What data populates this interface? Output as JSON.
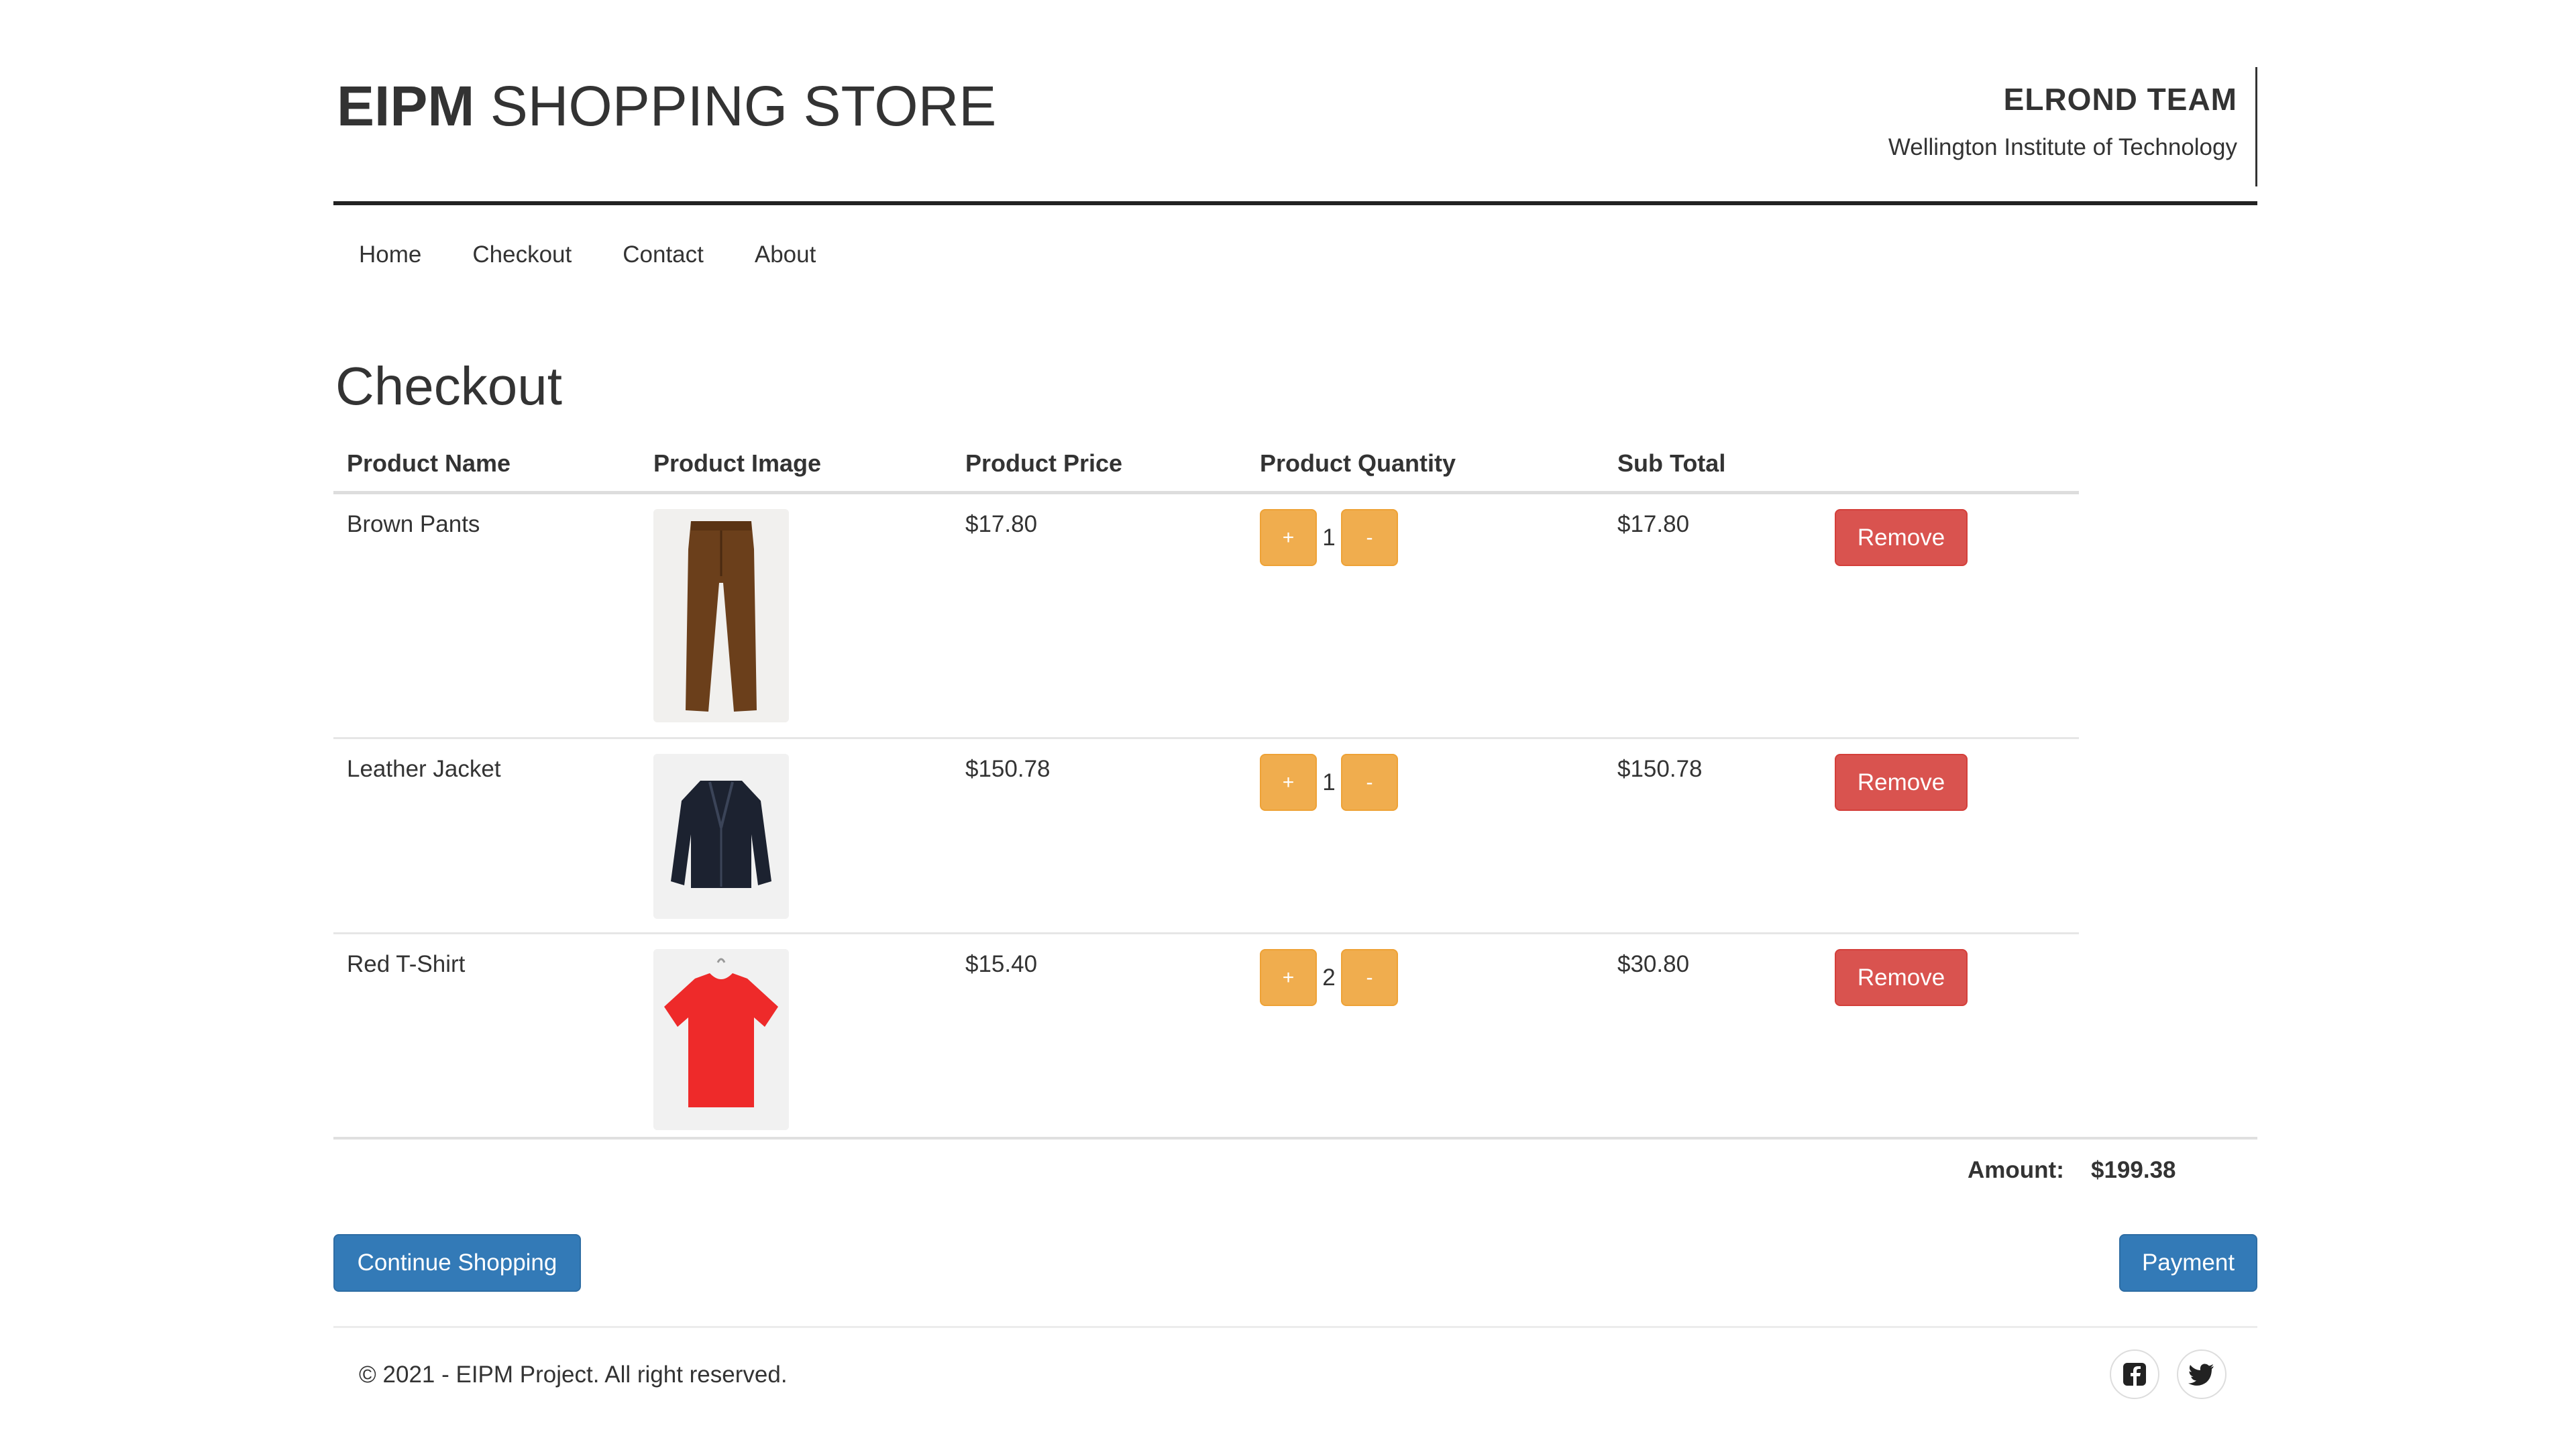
{
  "header": {
    "brand_bold": "EIPM",
    "brand_rest": "SHOPPING STORE",
    "team_name": "ELROND TEAM",
    "institute": "Wellington Institute of Technology"
  },
  "nav": {
    "items": [
      "Home",
      "Checkout",
      "Contact",
      "About"
    ]
  },
  "page_title": "Checkout",
  "table": {
    "headers": [
      "Product Name",
      "Product Image",
      "Product Price",
      "Product Quantity",
      "Sub Total"
    ],
    "rows": [
      {
        "name": "Brown Pants",
        "image": "brown-pants-image",
        "price": "$17.80",
        "quantity": "1",
        "subtotal": "$17.80",
        "plus": "+",
        "minus": "-",
        "remove": "Remove"
      },
      {
        "name": "Leather Jacket",
        "image": "leather-jacket-image",
        "price": "$150.78",
        "quantity": "1",
        "subtotal": "$150.78",
        "plus": "+",
        "minus": "-",
        "remove": "Remove"
      },
      {
        "name": "Red T-Shirt",
        "image": "red-tshirt-image",
        "price": "$15.40",
        "quantity": "2",
        "subtotal": "$30.80",
        "plus": "+",
        "minus": "-",
        "remove": "Remove"
      }
    ]
  },
  "summary": {
    "amount_label": "Amount:",
    "amount_value": "$199.38"
  },
  "actions": {
    "continue_label": "Continue Shopping",
    "payment_label": "Payment"
  },
  "footer": {
    "copyright": "© 2021 - EIPM Project. All right reserved.",
    "social_icons": [
      "facebook-icon",
      "twitter-icon"
    ]
  },
  "colors": {
    "primary": "#337ab7",
    "danger": "#d9534f",
    "warning": "#f0ad4e",
    "text": "#333333"
  }
}
